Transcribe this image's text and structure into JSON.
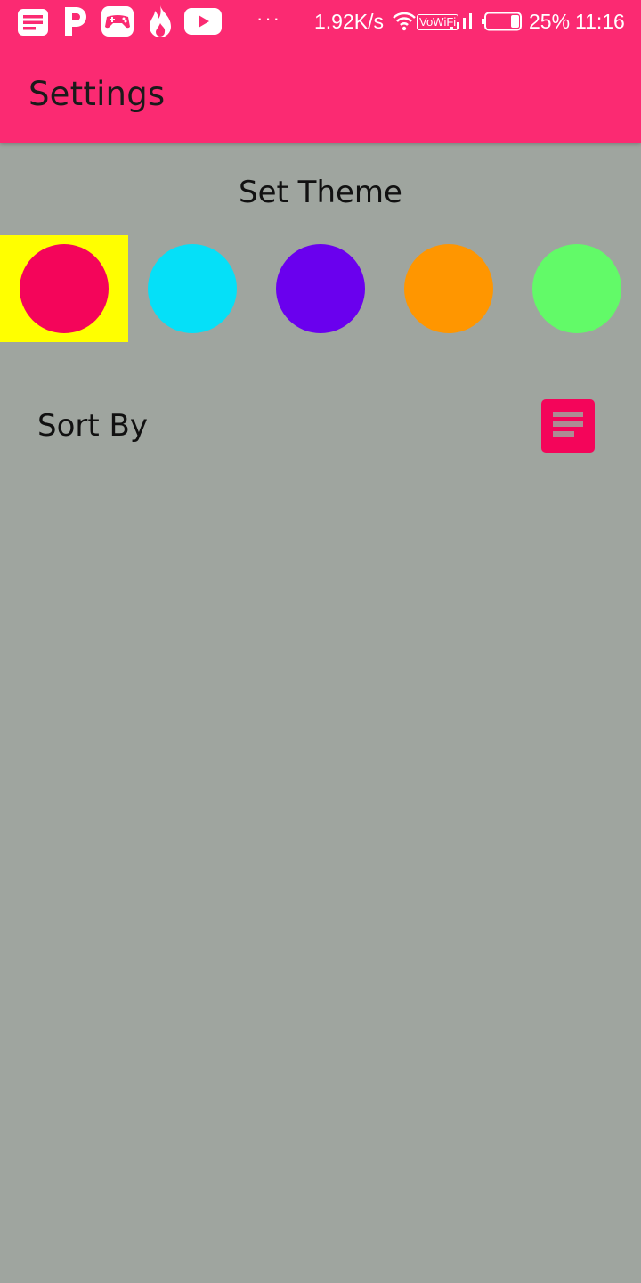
{
  "status_bar": {
    "network_speed": "1.92K/s",
    "vowifi_label": "VoWiFi",
    "battery_percent": "25%",
    "time": "11:16",
    "overflow_dots": "···",
    "icons": [
      "notes-icon",
      "p-app-icon",
      "game-controller-icon",
      "flame-icon",
      "youtube-icon",
      "wifi-icon",
      "signal-icon",
      "battery-icon"
    ]
  },
  "app_bar": {
    "title": "Settings",
    "color": "#fb2a72"
  },
  "theme_section": {
    "title": "Set Theme",
    "selected_index": 0,
    "selection_color": "#ffff00",
    "swatches": [
      {
        "name": "pink",
        "color": "#f4055a"
      },
      {
        "name": "cyan",
        "color": "#05e0f8"
      },
      {
        "name": "purple",
        "color": "#6a00ee"
      },
      {
        "name": "orange",
        "color": "#ff9600"
      },
      {
        "name": "green",
        "color": "#62fa68"
      }
    ]
  },
  "sort_section": {
    "label": "Sort By",
    "icon": "sort-icon",
    "button_color": "#f4055a"
  }
}
